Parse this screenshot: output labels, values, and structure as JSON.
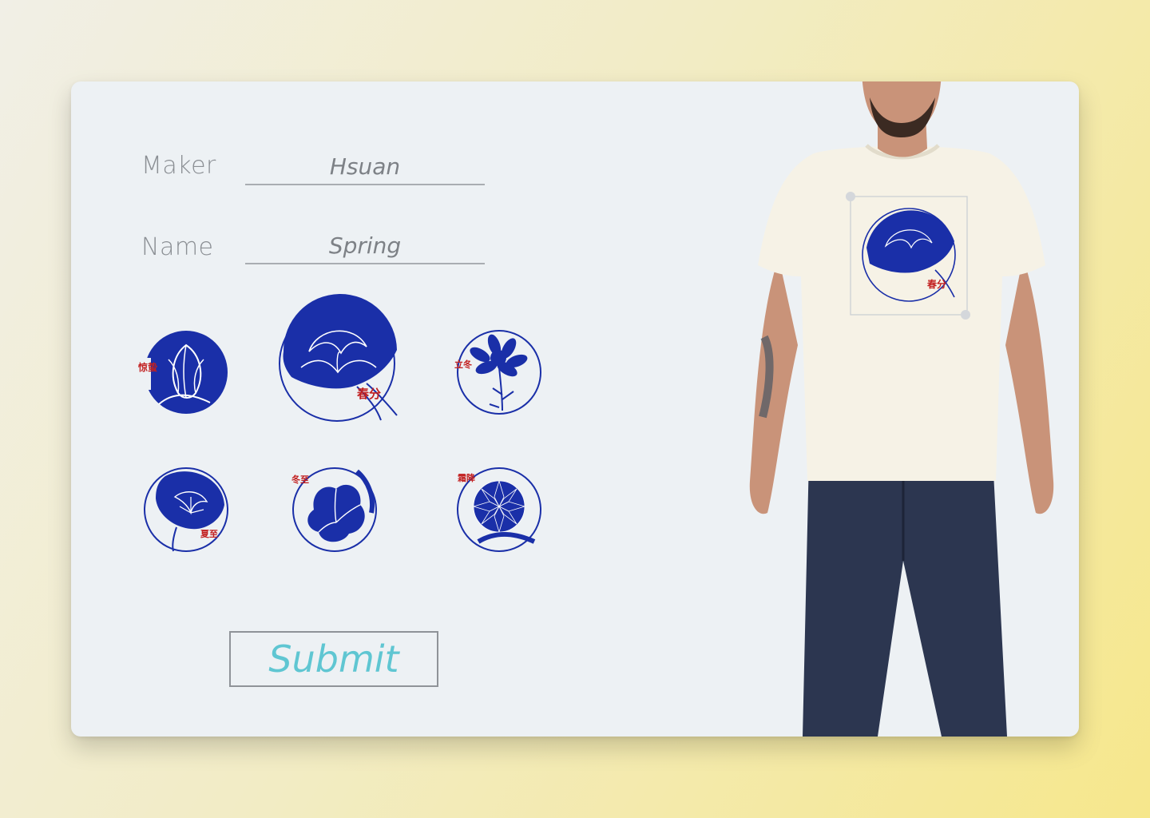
{
  "form": {
    "maker_label": "Maker",
    "maker_value": "Hsuan",
    "name_label": "Name",
    "name_value": "Spring",
    "submit_label": "Submit"
  },
  "stickers": [
    {
      "label": "惊蛰",
      "icon": "tulip-flower-icon"
    },
    {
      "label": "春分",
      "icon": "peony-flower-icon",
      "selected": true
    },
    {
      "label": "立冬",
      "icon": "daisy-flower-icon"
    },
    {
      "label": "夏至",
      "icon": "morning-glory-flower-icon"
    },
    {
      "label": "冬至",
      "icon": "camellia-flower-icon"
    },
    {
      "label": "霜降",
      "icon": "chrysanthemum-flower-icon"
    }
  ],
  "preview": {
    "applied_label": "春分",
    "applied_icon": "peony-flower-icon"
  },
  "colors": {
    "accent": "#5fc6d2",
    "flower_blue": "#1a2fa8",
    "stamp_red": "#c22020",
    "card_bg": "#edf1f4"
  }
}
